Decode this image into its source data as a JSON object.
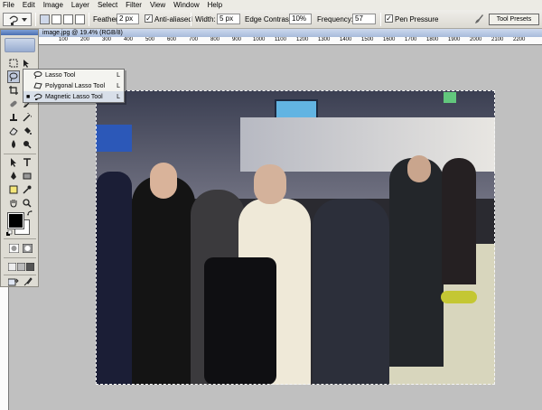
{
  "menubar": {
    "items": [
      "File",
      "Edit",
      "Image",
      "Layer",
      "Select",
      "Filter",
      "View",
      "Window",
      "Help"
    ]
  },
  "options": {
    "feather_label": "Feather:",
    "feather_value": "2 px",
    "antialiased_label": "Anti-aliased",
    "antialiased_checked": true,
    "width_label": "Width:",
    "width_value": "5 px",
    "edge_contrast_label": "Edge Contrast:",
    "edge_contrast_value": "10%",
    "frequency_label": "Frequency:",
    "frequency_value": "57",
    "pen_pressure_label": "Pen Pressure",
    "pen_pressure_checked": true,
    "tool_presets_tab": "Tool Presets"
  },
  "document": {
    "title": "image.jpg @ 19.4% (RGB/8)",
    "ruler_labels": [
      "100",
      "200",
      "300",
      "400",
      "500",
      "600",
      "700",
      "800",
      "900",
      "1000",
      "1100",
      "1200",
      "1300",
      "1400",
      "1500",
      "1600",
      "1700",
      "1800",
      "1900",
      "2000",
      "2100",
      "2200"
    ]
  },
  "flyout": {
    "items": [
      {
        "label": "Lasso Tool",
        "shortcut": "L",
        "icon": "lasso-icon",
        "current": false
      },
      {
        "label": "Polygonal Lasso Tool",
        "shortcut": "L",
        "icon": "polygonal-lasso-icon",
        "current": false
      },
      {
        "label": "Magnetic Lasso Tool",
        "shortcut": "L",
        "icon": "magnetic-lasso-icon",
        "current": true
      }
    ]
  },
  "toolbox": {
    "tools": [
      "marquee-icon",
      "move-icon",
      "lasso-icon",
      "magic-wand-icon",
      "crop-icon",
      "slice-icon",
      "healing-brush-icon",
      "brush-icon",
      "clone-stamp-icon",
      "history-brush-icon",
      "eraser-icon",
      "paint-bucket-icon",
      "blur-icon",
      "dodge-icon",
      "path-selection-icon",
      "type-icon",
      "pen-icon",
      "shape-icon",
      "notes-icon",
      "eyedropper-icon",
      "hand-icon",
      "zoom-icon"
    ]
  },
  "colors": {
    "foreground": "#000000",
    "background": "#ffffff",
    "selection_marquee": "#ffffff"
  }
}
